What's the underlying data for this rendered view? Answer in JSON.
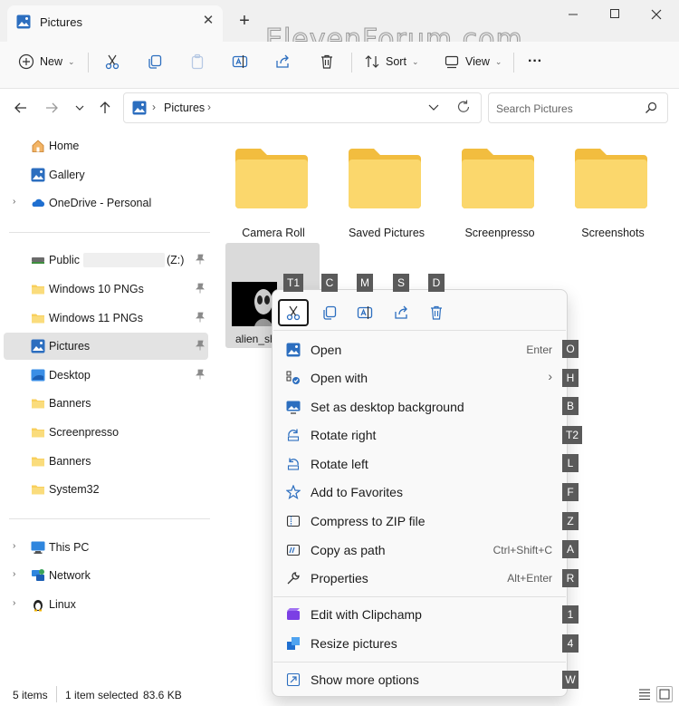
{
  "window": {
    "tab_title": "Pictures",
    "watermark": "ElevenForum.com"
  },
  "toolbar": {
    "new_label": "New",
    "sort_label": "Sort",
    "view_label": "View",
    "more_label": "···"
  },
  "address": {
    "location": "Pictures",
    "search_placeholder": "Search Pictures"
  },
  "nav": {
    "quick": [
      {
        "label": "Home"
      },
      {
        "label": "Gallery"
      },
      {
        "label": "OneDrive - Personal"
      }
    ],
    "pinned": [
      {
        "label": "Public",
        "suffix": "(Z:)"
      },
      {
        "label": "Windows 10 PNGs"
      },
      {
        "label": "Windows 11 PNGs"
      },
      {
        "label": "Pictures"
      },
      {
        "label": "Desktop"
      },
      {
        "label": "Banners"
      },
      {
        "label": "Screenpresso"
      },
      {
        "label": "Banners"
      },
      {
        "label": "System32"
      }
    ],
    "devices": [
      {
        "label": "This PC"
      },
      {
        "label": "Network"
      },
      {
        "label": "Linux"
      }
    ]
  },
  "content": {
    "folders": [
      {
        "name": "Camera Roll"
      },
      {
        "name": "Saved Pictures"
      },
      {
        "name": "Screenpresso"
      },
      {
        "name": "Screenshots"
      }
    ],
    "selected_file": "alien_sh"
  },
  "context_menu": {
    "quick_actions": [
      {
        "name": "Cut",
        "key": "T1"
      },
      {
        "name": "Copy",
        "key": "C"
      },
      {
        "name": "Rename",
        "key": "M"
      },
      {
        "name": "Share",
        "key": "S"
      },
      {
        "name": "Delete",
        "key": "D"
      }
    ],
    "items": [
      {
        "label": "Open",
        "shortcut": "Enter",
        "key": "O"
      },
      {
        "label": "Open with",
        "shortcut": "›",
        "key": "H"
      },
      {
        "label": "Set as desktop background",
        "shortcut": "",
        "key": "B"
      },
      {
        "label": "Rotate right",
        "shortcut": "",
        "key": "T2"
      },
      {
        "label": "Rotate left",
        "shortcut": "",
        "key": "L"
      },
      {
        "label": "Add to Favorites",
        "shortcut": "",
        "key": "F"
      },
      {
        "label": "Compress to ZIP file",
        "shortcut": "",
        "key": "Z"
      },
      {
        "label": "Copy as path",
        "shortcut": "Ctrl+Shift+C",
        "key": "A"
      },
      {
        "label": "Properties",
        "shortcut": "Alt+Enter",
        "key": "R"
      },
      {
        "label": "Edit with Clipchamp",
        "shortcut": "",
        "key": "1"
      },
      {
        "label": "Resize pictures",
        "shortcut": "",
        "key": "4"
      },
      {
        "label": "Show more options",
        "shortcut": "",
        "key": "W"
      }
    ]
  },
  "status": {
    "count": "5 items",
    "selection": "1 item selected",
    "size": "83.6 KB"
  },
  "colors": {
    "accent": "#2c6ebf",
    "folder": "#f8cf5c",
    "selection": "#e3e3e3",
    "keytip": "#5a5a5a"
  }
}
